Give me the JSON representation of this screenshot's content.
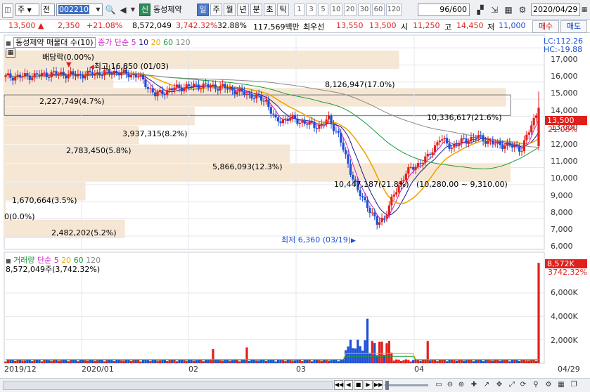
{
  "toolbar": {
    "mode1": "주",
    "mode2": "전",
    "code": "002210",
    "badge": "신",
    "name": "동성제약",
    "periods": [
      {
        "label": "일",
        "selected": true
      },
      {
        "label": "주",
        "selected": false
      },
      {
        "label": "월",
        "selected": false
      },
      {
        "label": "년",
        "selected": false
      },
      {
        "label": "분",
        "selected": false
      },
      {
        "label": "초",
        "selected": false
      },
      {
        "label": "틱",
        "selected": false
      }
    ],
    "intervals": [
      "1",
      "3",
      "5",
      "10",
      "20",
      "30",
      "60",
      "120"
    ],
    "count": "96/600",
    "date": "2020/04/29"
  },
  "quote": {
    "price": "13,500",
    "change_arrow": "▲",
    "change": "2,350",
    "change_rate": "+21.08%",
    "volume": "8,572,049",
    "volume_ratio": "3,742.32%",
    "turnover": "32.88%",
    "amount": "117,569백만",
    "pref_label": "최우선",
    "ask": "13,550",
    "bid": "13,500",
    "open_label": "시",
    "open": "11,250",
    "high_label": "고",
    "high": "14,450",
    "low_label": "저",
    "low": "11,000",
    "buy": "매수",
    "sell": "매도"
  },
  "colors": {
    "up": "#e0201b",
    "down": "#1d4fd6",
    "ma5": "#d21ec8",
    "ma10": "#1a1a8c",
    "ma20": "#f0a500",
    "ma60": "#1a9c3a",
    "ma120": "#8a8a8a",
    "band": "#f6e6d4"
  },
  "price_panel": {
    "title": "동성제약 매물대 수(10)",
    "ma_label": "종가 단순",
    "ma_periods": [
      "5",
      "10",
      "20",
      "60",
      "120"
    ],
    "lc": "LC:112.26",
    "hc": "HC:-19.88",
    "ex_rights": "배당락(0.00%)",
    "high_note": "최고 16,850 (01/03)",
    "low_note": "최저 6,360 (03/19)",
    "range_note": "(10,280.00 ~ 9,310.00)",
    "price_tag": "13,500",
    "rate_tag": "21.08%",
    "y_ticks": [
      "17,000",
      "16,000",
      "15,000",
      "14,000",
      "13,000",
      "12,000",
      "11,000",
      "10,000",
      "9,000",
      "8,000",
      "7,000",
      "6,000"
    ],
    "bands": [
      {
        "label": "8,126,947(17.0%)"
      },
      {
        "label": "2,227,749(4.7%)"
      },
      {
        "label": "10,336,617(21.6%)"
      },
      {
        "label": "3,937,315(8.2%)"
      },
      {
        "label": "2,783,450(5.8%)"
      },
      {
        "label": "5,866,093(12.3%)"
      },
      {
        "label": "10,447,187(21.8%)"
      },
      {
        "label": "1,670,664(3.5%)"
      },
      {
        "label": "0(0.0%)"
      },
      {
        "label": "2,482,202(5.2%)"
      }
    ]
  },
  "volume_panel": {
    "title": "거래량",
    "ma_label": "단순",
    "ma_periods": [
      "5",
      "20",
      "60",
      "120"
    ],
    "value": "8,572,049주(3,742.32%)",
    "tag": "8,572K",
    "tag_rate": "3742.32%",
    "y_ticks": [
      "6,000K",
      "4,000K",
      "2,000K"
    ]
  },
  "x_axis": [
    "2019/12",
    "2020/01",
    "02",
    "03",
    "04",
    "04/29"
  ],
  "chart_data": {
    "type": "candlestick",
    "x": [
      "2019-12",
      "2020-01",
      "2020-02",
      "2020-03",
      "2020-04"
    ],
    "high": {
      "value": 16850,
      "date": "01/03"
    },
    "low": {
      "value": 6360,
      "date": "03/19"
    },
    "last": {
      "date": "2020/04/29",
      "close": 13500,
      "open": 11250,
      "high": 14450,
      "low": 11000,
      "change_pct": 21.08,
      "volume": 8572049
    },
    "ylim": [
      5500,
      17500
    ],
    "volume_profile": [
      {
        "volume": 8126947,
        "pct": 17.0
      },
      {
        "volume": 2227749,
        "pct": 4.7
      },
      {
        "volume": 10336617,
        "pct": 21.6
      },
      {
        "volume": 3937315,
        "pct": 8.2
      },
      {
        "volume": 2783450,
        "pct": 5.8
      },
      {
        "volume": 5866093,
        "pct": 12.3
      },
      {
        "volume": 10447187,
        "pct": 21.8
      },
      {
        "volume": 1670664,
        "pct": 3.5
      },
      {
        "volume": 0,
        "pct": 0.0
      },
      {
        "volume": 2482202,
        "pct": 5.2
      }
    ]
  }
}
